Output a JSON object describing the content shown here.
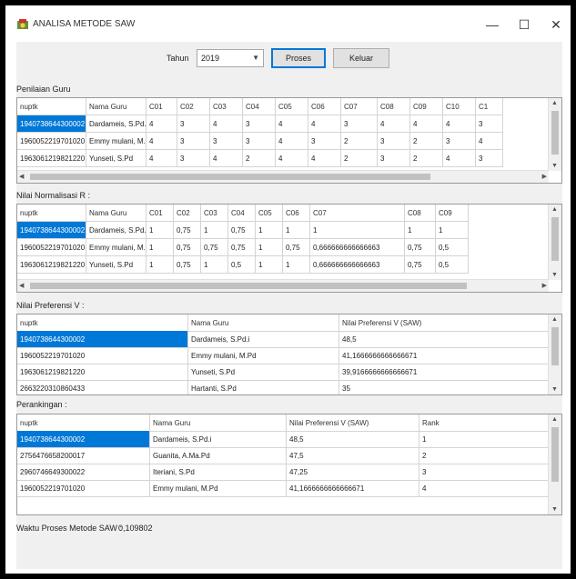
{
  "window": {
    "title": "ANALISA METODE SAW",
    "minimize": "—",
    "maximize": "☐",
    "close": "✕"
  },
  "toolbar": {
    "year_label": "Tahun",
    "year_value": "2019",
    "process_label": "Proses",
    "exit_label": "Keluar"
  },
  "section1": {
    "label": "Penilaian Guru",
    "headers": [
      "nuptk",
      "Nama Guru",
      "C01",
      "C02",
      "C03",
      "C04",
      "C05",
      "C06",
      "C07",
      "C08",
      "C09",
      "C10",
      "C1"
    ],
    "rows": [
      [
        "1940738644300002",
        "Dardameis, S.Pd.i",
        "4",
        "3",
        "4",
        "3",
        "4",
        "4",
        "3",
        "4",
        "4",
        "4",
        "3"
      ],
      [
        "1960052219701020",
        "Emmy mulani, M.Pd",
        "4",
        "3",
        "3",
        "3",
        "4",
        "3",
        "2",
        "3",
        "2",
        "3",
        "4"
      ],
      [
        "1963061219821220",
        "Yunseti, S.Pd",
        "4",
        "3",
        "4",
        "2",
        "4",
        "4",
        "2",
        "3",
        "2",
        "4",
        "3"
      ]
    ]
  },
  "section2": {
    "label": "Nilai Normalisasi R :",
    "headers": [
      "nuptk",
      "Nama Guru",
      "C01",
      "C02",
      "C03",
      "C04",
      "C05",
      "C06",
      "C07",
      "C08",
      "C09"
    ],
    "rows": [
      [
        "1940738644300002",
        "Dardameis, S.Pd.i",
        "1",
        "0,75",
        "1",
        "0,75",
        "1",
        "1",
        "1",
        "1",
        "1"
      ],
      [
        "1960052219701020",
        "Emmy mulani, M.Pd",
        "1",
        "0,75",
        "0,75",
        "0,75",
        "1",
        "0,75",
        "0,666666666666663",
        "0,75",
        "0,5"
      ],
      [
        "1963061219821220",
        "Yunseti, S.Pd",
        "1",
        "0,75",
        "1",
        "0,5",
        "1",
        "1",
        "0,666666666666663",
        "0,75",
        "0,5"
      ]
    ]
  },
  "section3": {
    "label": "Nilai Preferensi V :",
    "headers": [
      "nuptk",
      "Nama Guru",
      "Nilai Preferensi V (SAW)"
    ],
    "rows": [
      [
        "1940738644300002",
        "Dardameis, S.Pd.i",
        "48,5"
      ],
      [
        "1960052219701020",
        "Emmy mulani, M.Pd",
        "41,1666666666666671"
      ],
      [
        "1963061219821220",
        "Yunseti, S.Pd",
        "39,9166666666666671"
      ],
      [
        "2663220310860433",
        "Hartanti, S.Pd",
        "35"
      ]
    ]
  },
  "section4": {
    "label": "Perankingan :",
    "headers": [
      "nuptk",
      "Nama Guru",
      "Nilai Preferensi V (SAW)",
      "Rank"
    ],
    "rows": [
      [
        "1940738644300002",
        "Dardameis, S.Pd.i",
        "48,5",
        "1"
      ],
      [
        "2756476658200017",
        "Guanita, A.Ma.Pd",
        "47,5",
        "2"
      ],
      [
        "2960746649300022",
        "Iteriani, S.Pd",
        "47,25",
        "3"
      ],
      [
        "1960052219701020",
        "Emmy mulani, M.Pd",
        "41,1666666666666671",
        "4"
      ]
    ]
  },
  "status": {
    "label": "Waktu Proses Metode SAW :",
    "value": "0,109802"
  }
}
